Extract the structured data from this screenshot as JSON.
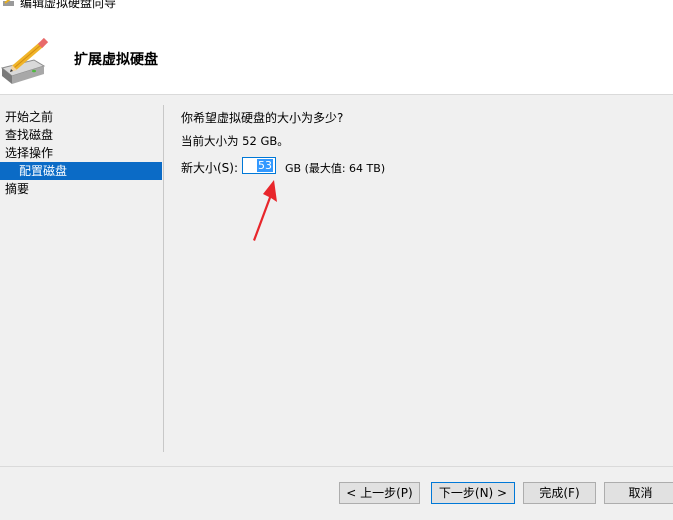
{
  "window": {
    "title": "编辑虚拟硬盘向导"
  },
  "header": {
    "title": "扩展虚拟硬盘"
  },
  "sidebar": {
    "items": [
      {
        "label": "开始之前"
      },
      {
        "label": "查找磁盘"
      },
      {
        "label": "选择操作"
      },
      {
        "label": "配置磁盘"
      },
      {
        "label": "摘要"
      }
    ]
  },
  "main": {
    "question": "你希望虚拟硬盘的大小为多少?",
    "current_size": "当前大小为 52 GB。",
    "new_size_label": "新大小(S):",
    "new_size_value": "53",
    "new_size_unit": "GB (最大值: 64 TB)"
  },
  "buttons": {
    "back": "< 上一步(P)",
    "next": "下一步(N) >",
    "finish": "完成(F)",
    "cancel": "取消"
  },
  "colors": {
    "accent": "#0b6bc6",
    "selection": "#3399ff",
    "arrow": "#e8262b"
  },
  "icons": {
    "wizard": "disk-with-pencil-icon"
  }
}
